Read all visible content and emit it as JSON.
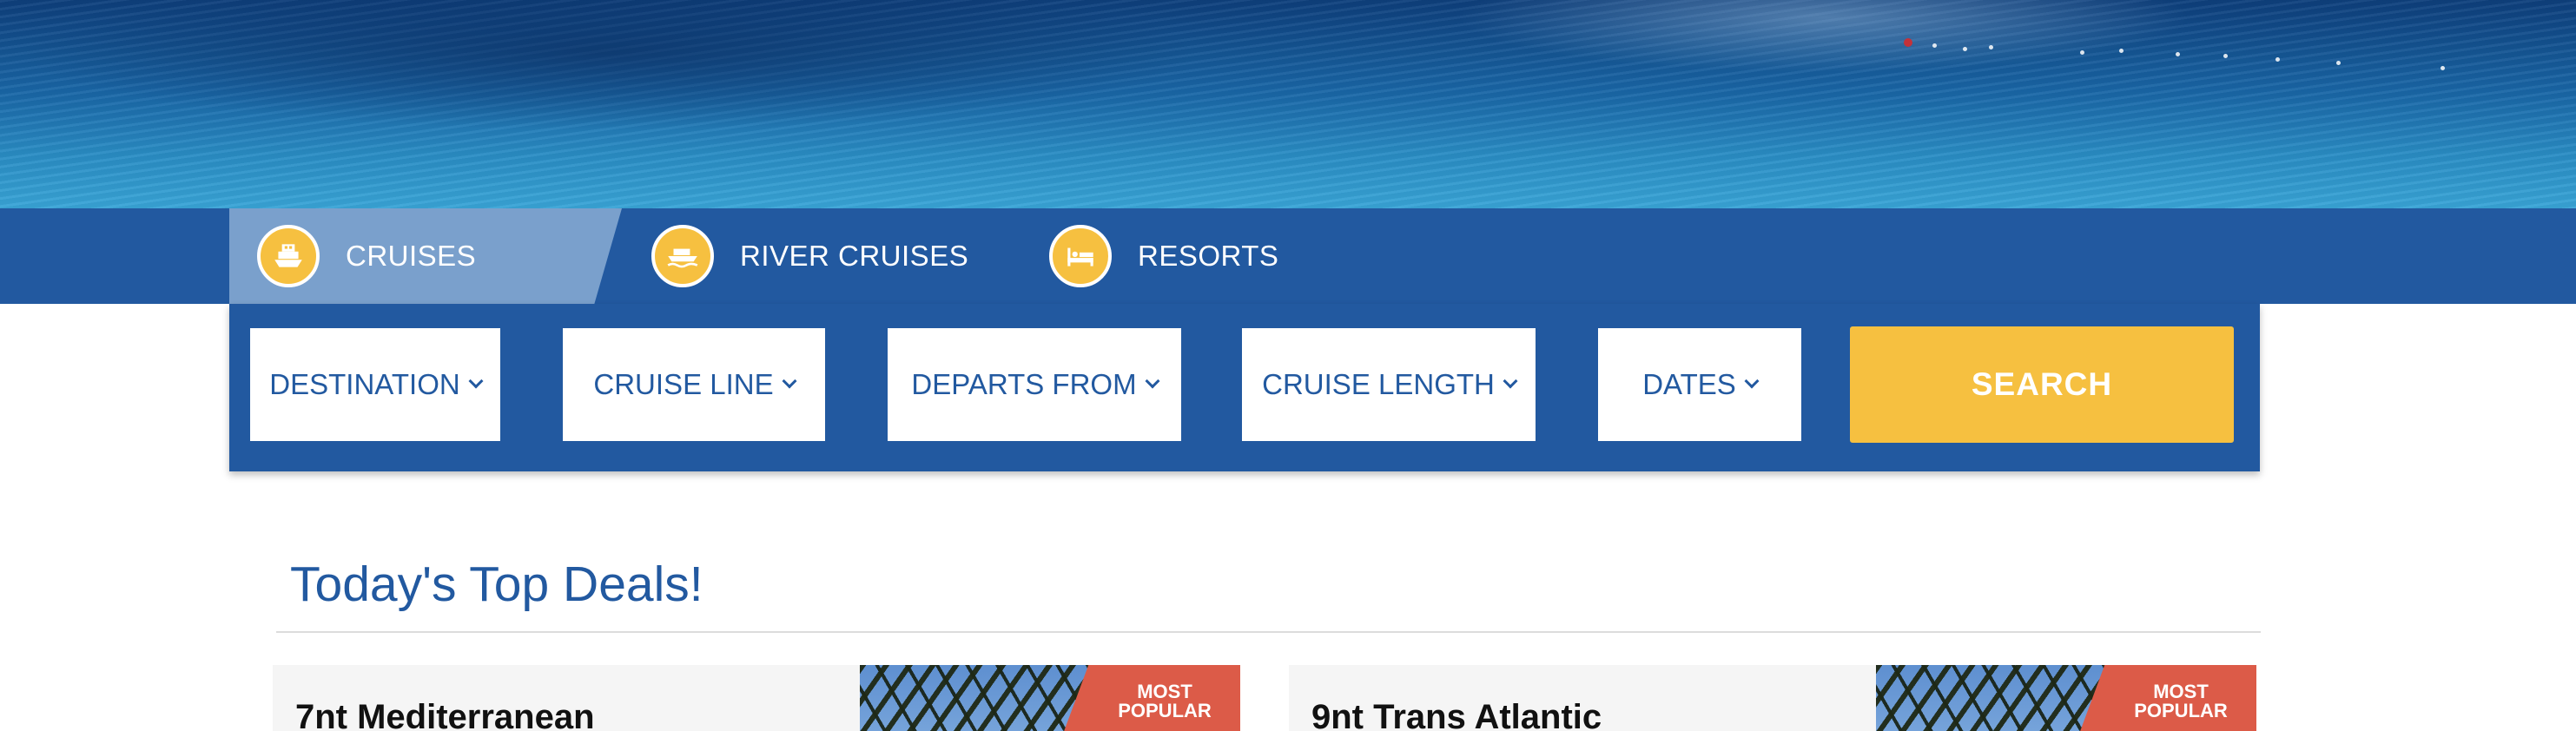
{
  "tabs": [
    {
      "label": "CRUISES",
      "icon": "ship-icon",
      "active": true
    },
    {
      "label": "RIVER CRUISES",
      "icon": "river-boat-icon",
      "active": false
    },
    {
      "label": "RESORTS",
      "icon": "bed-icon",
      "active": false
    }
  ],
  "filters": {
    "destination": "DESTINATION",
    "cruise_line": "CRUISE LINE",
    "departs_from": "DEPARTS FROM",
    "cruise_length": "CRUISE LENGTH",
    "dates": "DATES"
  },
  "search_label": "SEARCH",
  "deals": {
    "title": "Today's Top Deals!",
    "cards": [
      {
        "title": "7nt Mediterranean",
        "badge_line1": "MOST",
        "badge_line2": "POPULAR"
      },
      {
        "title": "9nt Trans Atlantic",
        "badge_line1": "MOST",
        "badge_line2": "POPULAR"
      }
    ]
  },
  "colors": {
    "primary_blue": "#2259a0",
    "active_tab": "#7aa0cc",
    "accent_yellow": "#f6c040",
    "badge_red": "#dc5b48"
  }
}
